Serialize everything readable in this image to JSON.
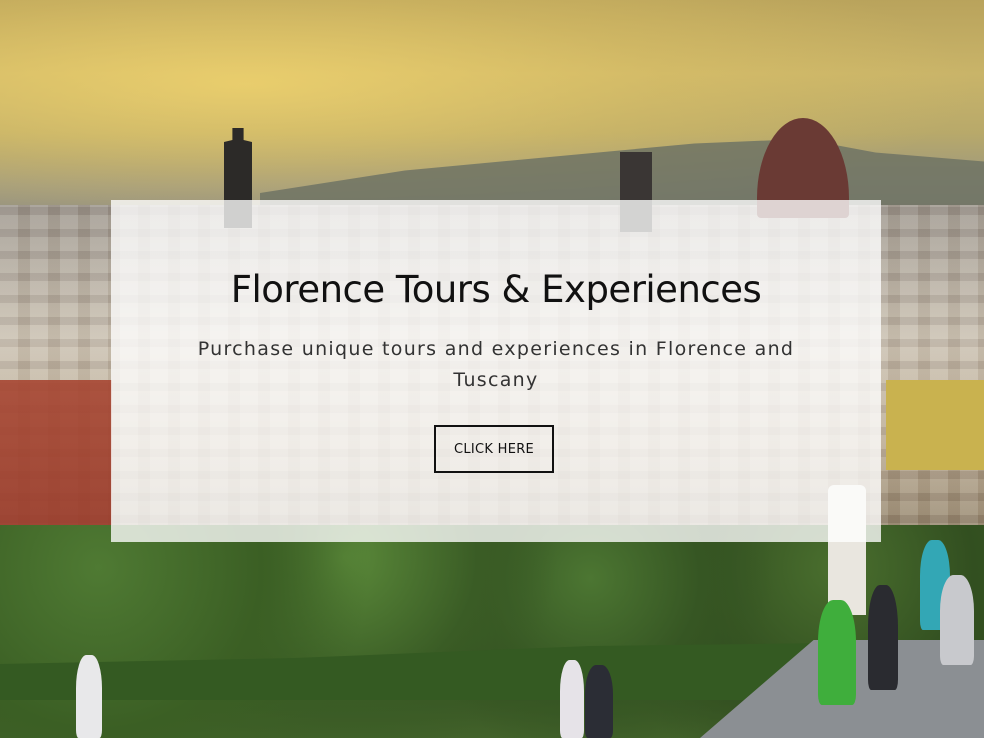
{
  "hero": {
    "title": "Florence Tours & Experiences",
    "subtitle": "Purchase unique tours and experiences in Florence and Tuscany",
    "cta_label": "CLICK HERE"
  },
  "colors": {
    "card_background": "#ffffff",
    "text_primary": "#111111",
    "text_secondary": "#333333",
    "button_border": "#111111"
  }
}
